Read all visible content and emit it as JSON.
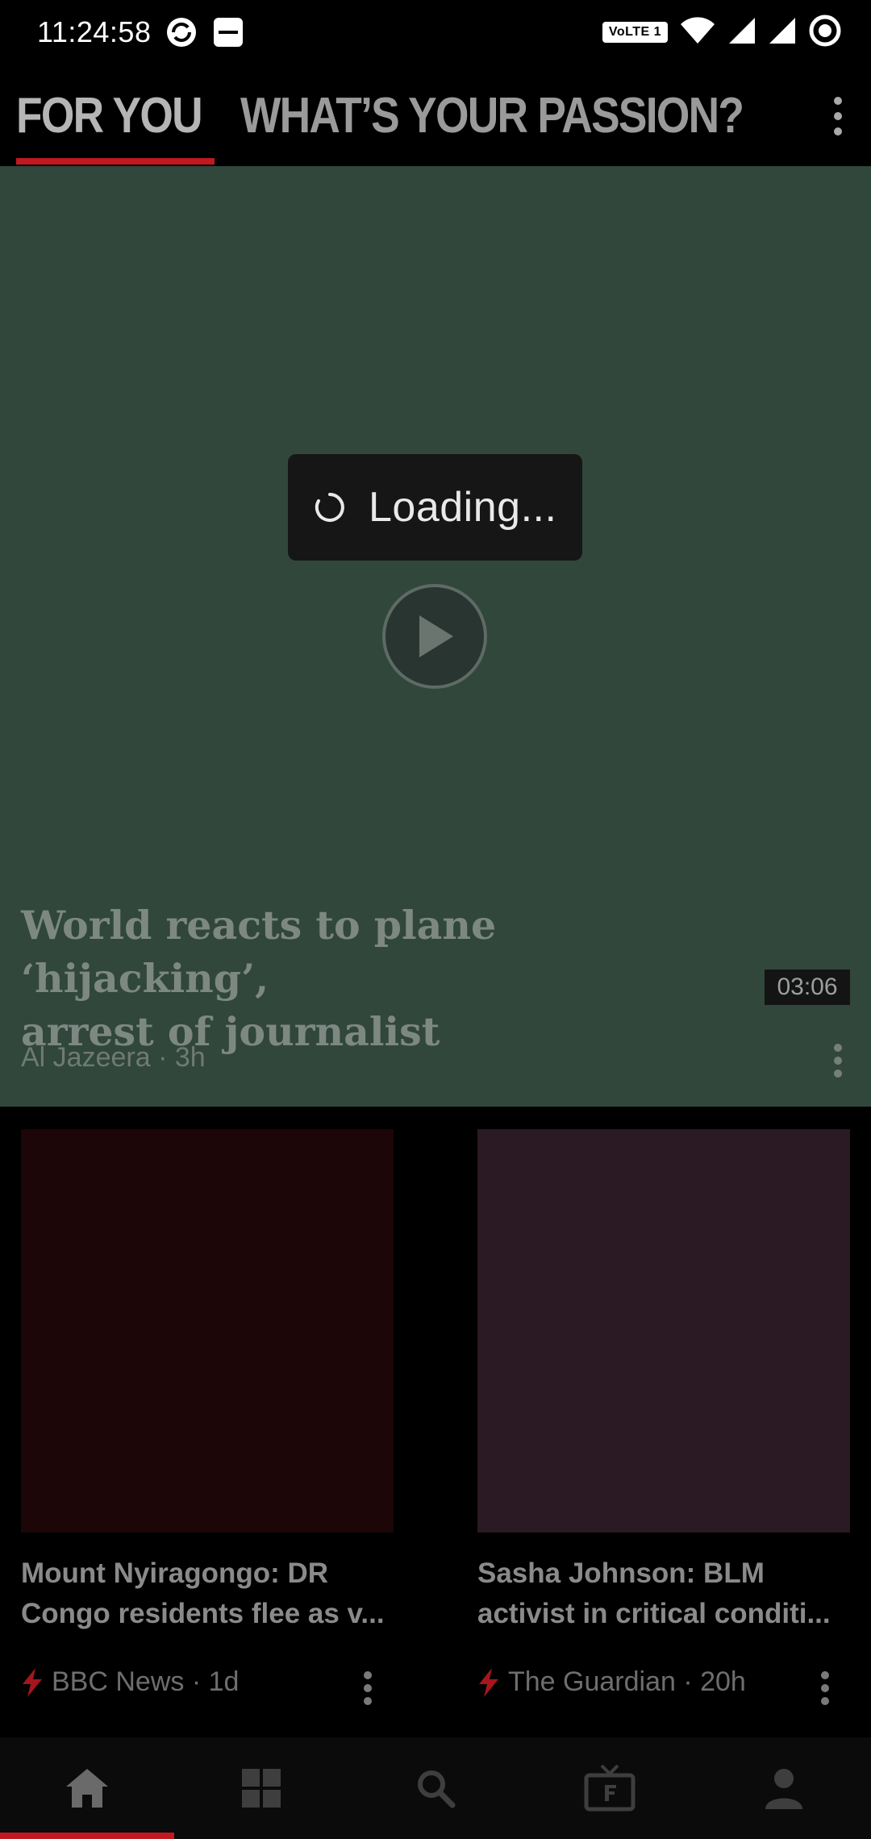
{
  "status_bar": {
    "time": "11:24:58",
    "volte_label": "VoLTE 1"
  },
  "tabs": [
    {
      "label": "FOR YOU",
      "active": true
    },
    {
      "label": "WHAT’S YOUR PASSION?",
      "active": false
    }
  ],
  "hero": {
    "title_line1": "World reacts to plane ‘hijacking’,",
    "title_line2": "arrest of journalist",
    "duration": "03:06",
    "source": "Al Jazeera · 3h"
  },
  "loading": {
    "text": "Loading..."
  },
  "cards": [
    {
      "title_line1": "Mount Nyiragongo: DR",
      "title_line2": "Congo residents flee as v...",
      "source": "BBC News · 1d",
      "image_color": "#1c0607"
    },
    {
      "title_line1": "Sasha Johnson: BLM",
      "title_line2": "activist in critical conditi...",
      "source": "The Guardian · 20h",
      "image_color": "#2b1923"
    }
  ],
  "bottom_nav": {
    "items": [
      "home-icon",
      "grid-icon",
      "search-icon",
      "tv-icon",
      "profile-icon"
    ],
    "active_index": 0
  },
  "colors": {
    "accent": "#c2181f",
    "hero_background": "#31473c"
  }
}
